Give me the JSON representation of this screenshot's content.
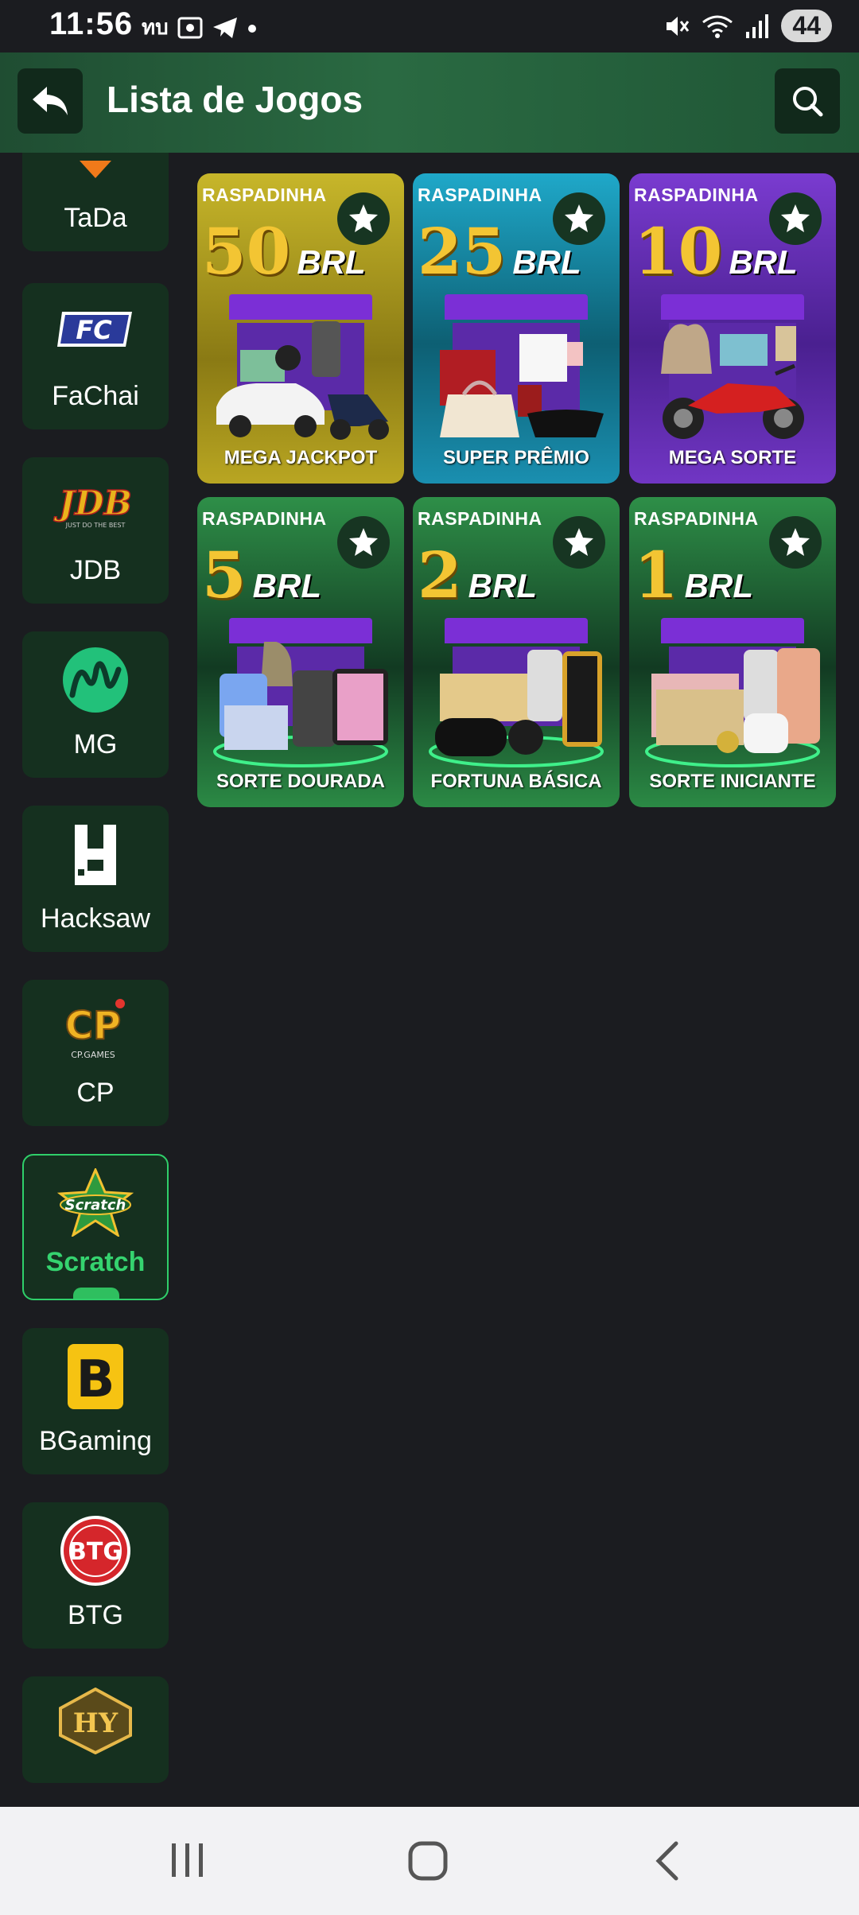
{
  "status": {
    "time": "11:56",
    "carrier": "ทบ",
    "battery": "44"
  },
  "header": {
    "title": "Lista de Jogos"
  },
  "providers": [
    {
      "label": "TaDa"
    },
    {
      "label": "FaChai"
    },
    {
      "label": "JDB"
    },
    {
      "label": "MG"
    },
    {
      "label": "Hacksaw"
    },
    {
      "label": "CP"
    },
    {
      "label": "Scratch",
      "active": true
    },
    {
      "label": "BGaming"
    },
    {
      "label": "BTG"
    },
    {
      "label": "HY"
    }
  ],
  "games": [
    {
      "tag": "RASPADINHA",
      "amount": "50",
      "currency": "BRL",
      "name": "MEGA JACKPOT",
      "bg": "#b7a41c"
    },
    {
      "tag": "RASPADINHA",
      "amount": "25",
      "currency": "BRL",
      "name": "SUPER PRÊMIO",
      "bg": "#1b97b8"
    },
    {
      "tag": "RASPADINHA",
      "amount": "10",
      "currency": "BRL",
      "name": "MEGA SORTE",
      "bg": "#6b33b8"
    },
    {
      "tag": "RASPADINHA",
      "amount": "5",
      "currency": "BRL",
      "name": "SORTE DOURADA",
      "bg": "#2f8a4a"
    },
    {
      "tag": "RASPADINHA",
      "amount": "2",
      "currency": "BRL",
      "name": "FORTUNA BÁSICA",
      "bg": "#2f8a4a"
    },
    {
      "tag": "RASPADINHA",
      "amount": "1",
      "currency": "BRL",
      "name": "SORTE INICIANTE",
      "bg": "#2f8a4a"
    }
  ],
  "colors": {
    "background": "#1b1c20",
    "header": "#2a6a42",
    "accent": "#2fcf6a",
    "gold": "#f3c533"
  },
  "logos": {
    "fachai": "FC",
    "jdb": "JDB",
    "jdb_tagline": "JUST DO THE BEST",
    "mg": "M",
    "hacksaw": "H",
    "cp": "CP",
    "cp_sub": "CP.GAMES",
    "scratch": "Scratch",
    "bgaming": "B",
    "btg": "BTG",
    "hy": "HY"
  }
}
